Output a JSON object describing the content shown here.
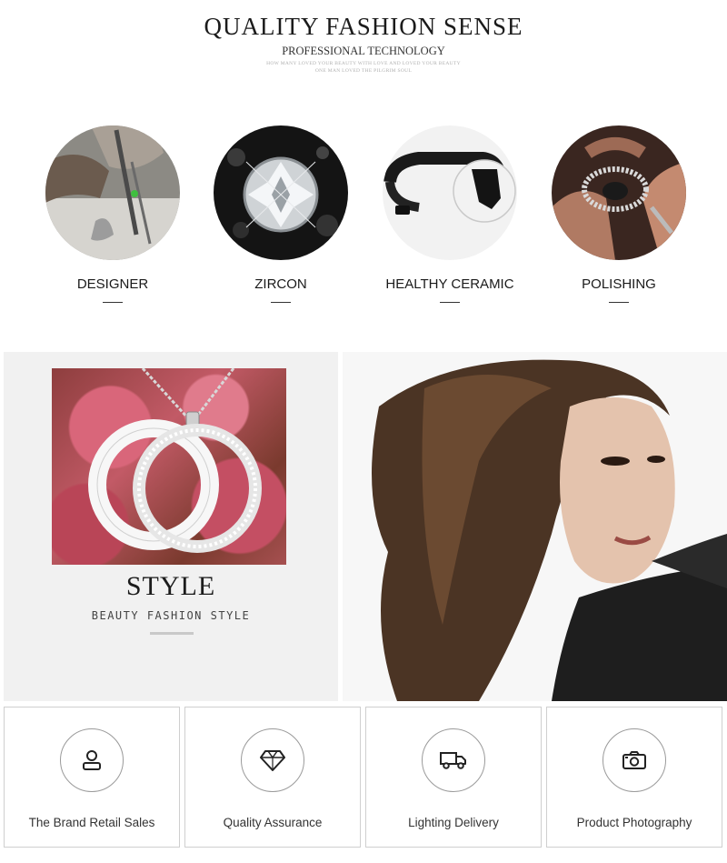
{
  "header": {
    "title": "QUALITY FASHION SENSE",
    "subtitle": "PROFESSIONAL TECHNOLOGY",
    "fine_line_1": "HOW MANY LOVED YOUR BEAUTY WITH LOVE AND LOVED YOUR BEAUTY",
    "fine_line_2": "ONE MAN LOVED THE PILGRIM SOUL"
  },
  "features": [
    {
      "label": "DESIGNER",
      "image": "designer-photo"
    },
    {
      "label": "ZIRCON",
      "image": "zircon-photo"
    },
    {
      "label": "HEALTHY CERAMIC",
      "image": "ceramic-ring-photo"
    },
    {
      "label": "POLISHING",
      "image": "polishing-photo"
    }
  ],
  "style_panel": {
    "title": "STYLE",
    "subtitle": "BEAUTY FASHION STYLE",
    "image": "double-ring-pendant-photo"
  },
  "model": {
    "image": "fashion-model-photo"
  },
  "services": [
    {
      "label": "The Brand Retail Sales",
      "icon": "user-icon"
    },
    {
      "label": "Quality Assurance",
      "icon": "diamond-icon"
    },
    {
      "label": "Lighting Delivery",
      "icon": "truck-icon"
    },
    {
      "label": "Product Photography",
      "icon": "camera-icon"
    }
  ],
  "colors": {
    "text": "#1b1b1b",
    "panel_bg": "#f1f1f1",
    "card_border": "#cfcfcf"
  }
}
